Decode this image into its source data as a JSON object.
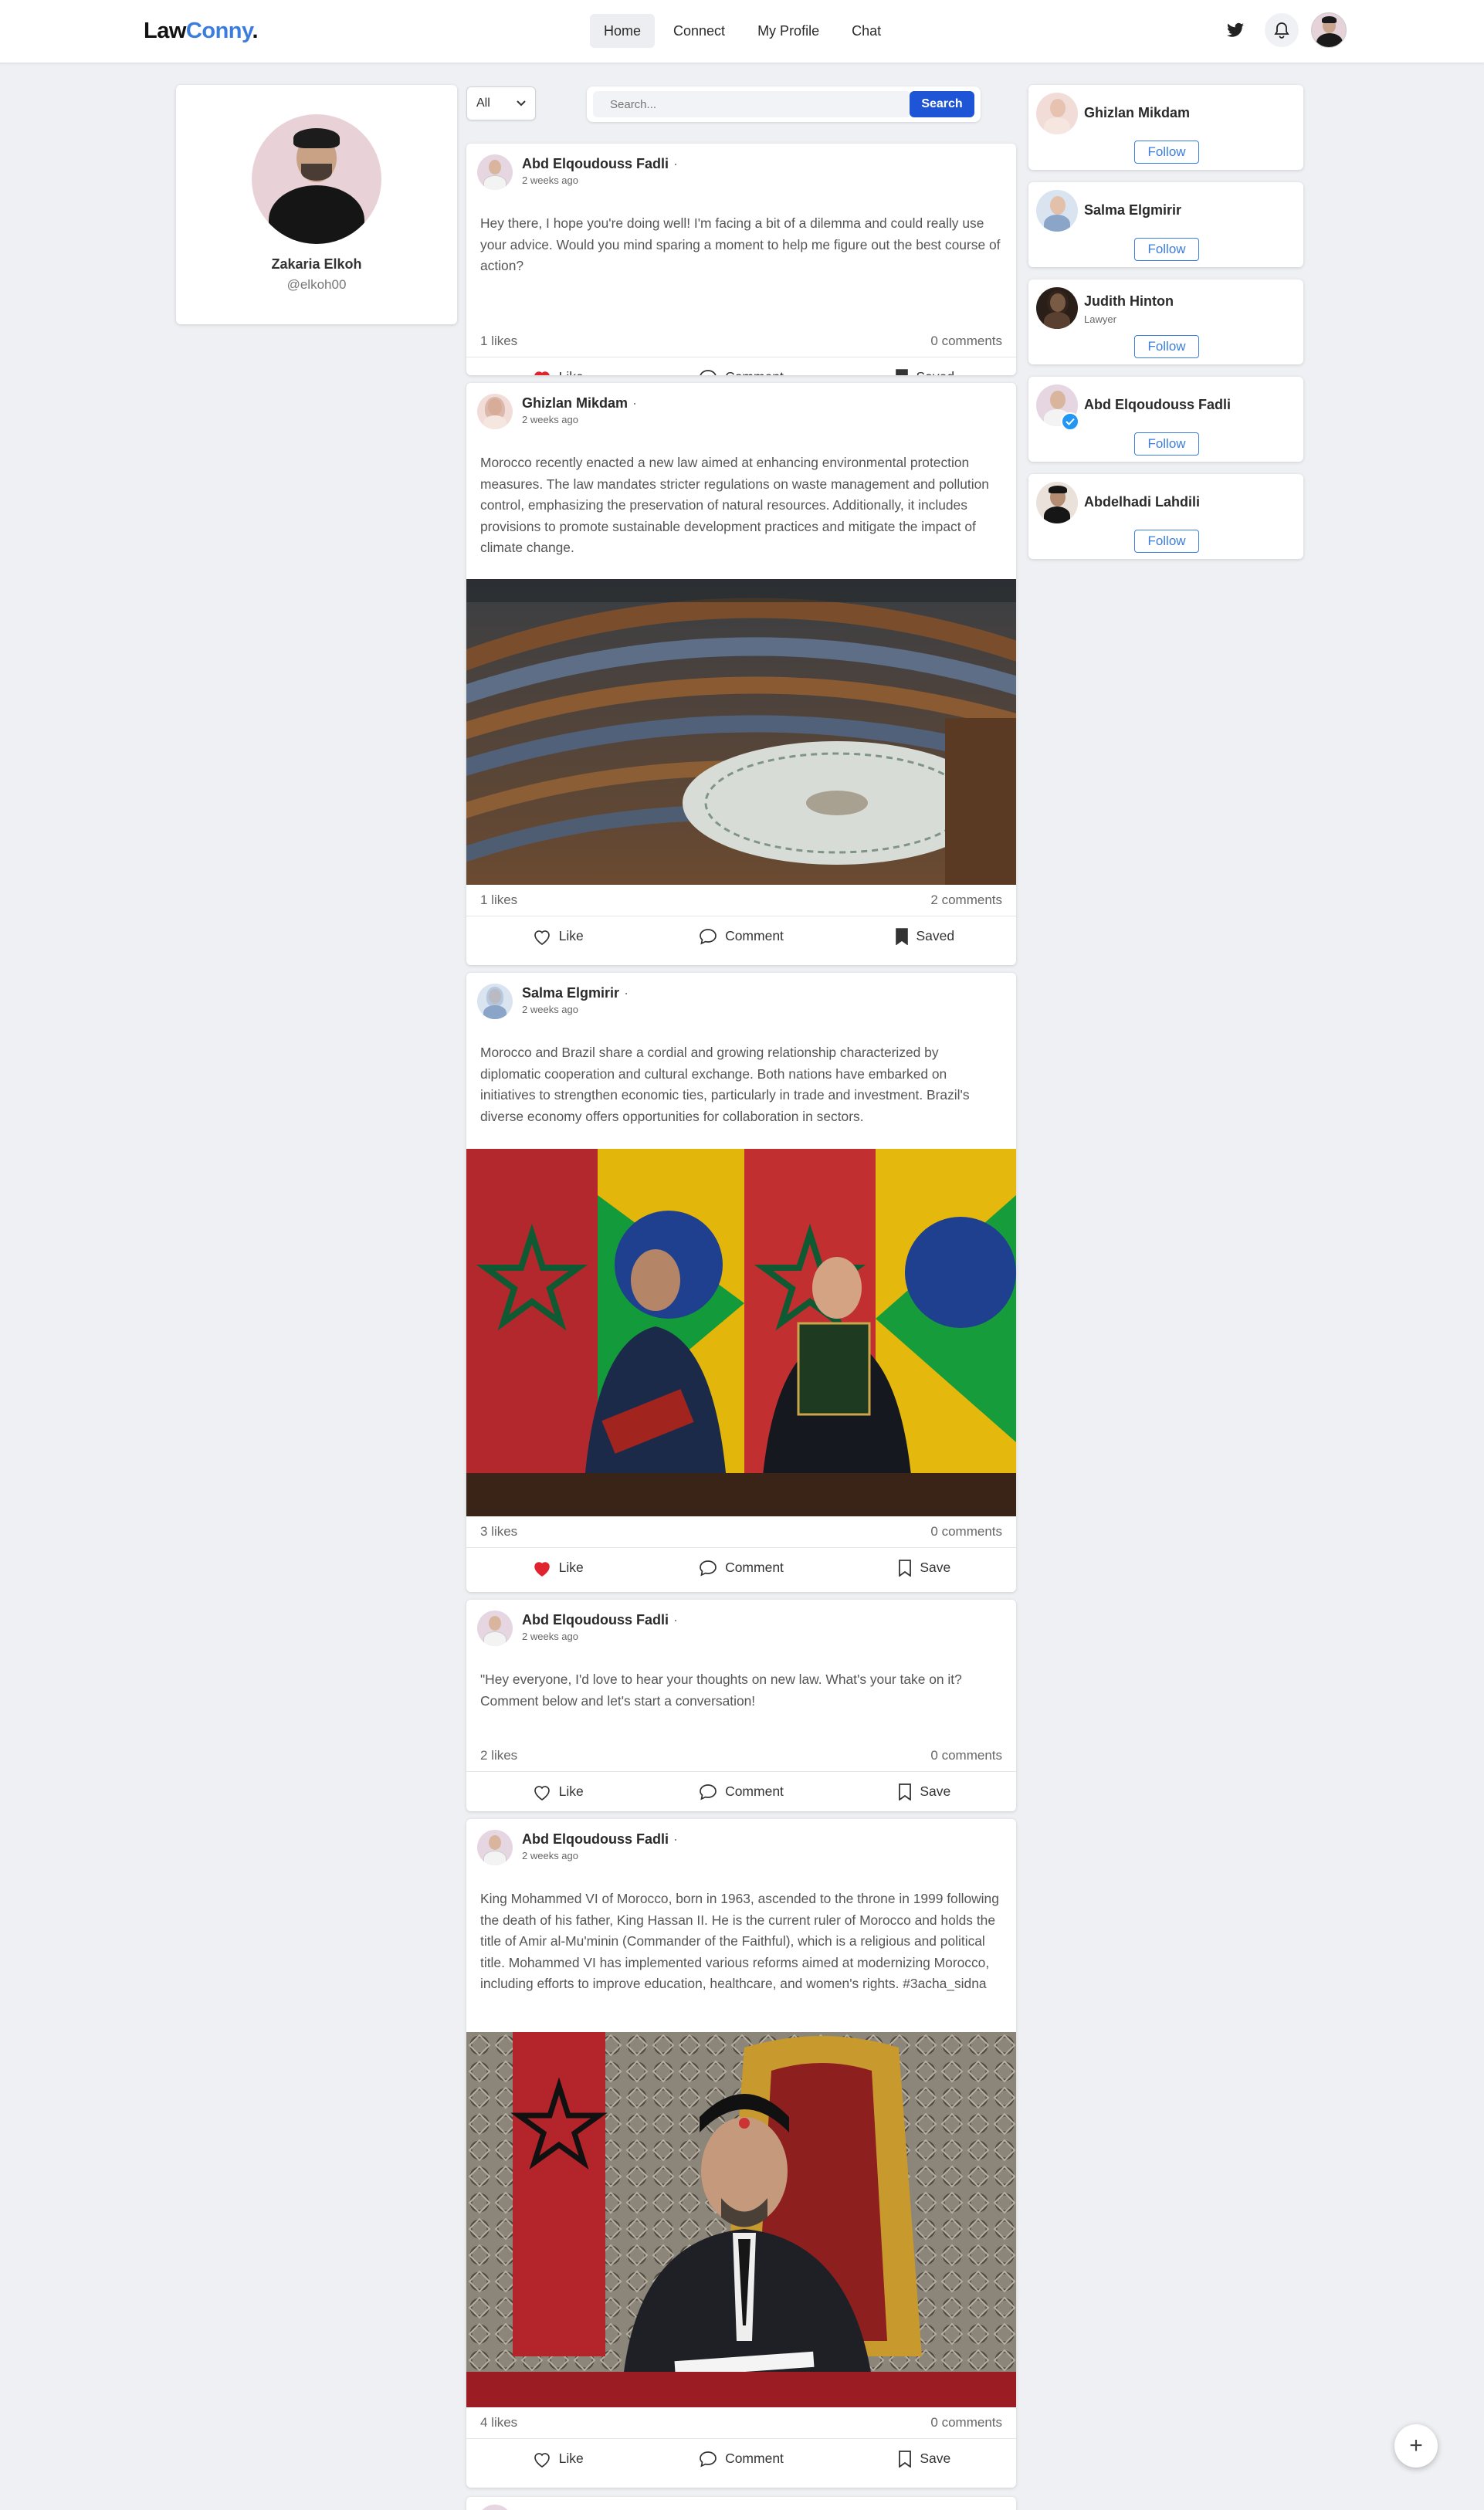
{
  "brand": {
    "name_main": "Law",
    "name_accent": "Conny",
    "name_dot": "."
  },
  "nav": {
    "links": [
      "Home",
      "Connect",
      "My Profile",
      "Chat"
    ],
    "active": "Home"
  },
  "profile": {
    "name": "Zakaria Elkoh",
    "handle": "@elkoh00"
  },
  "filter": {
    "selected": "All"
  },
  "search": {
    "placeholder": "Search...",
    "button": "Search"
  },
  "posts": [
    {
      "author": "Abd Elqoudouss Fadli",
      "separator": "·",
      "time": "2 weeks ago",
      "text": "Hey there, I hope you're doing well! I'm facing a bit of a dilemma and could really use your advice. Would you mind sparing a moment to help me figure out the best course of action?",
      "likes": "1 likes",
      "comments": "0 comments",
      "like_label": "Like",
      "liked": true,
      "comment_label": "Comment",
      "save_label": "Saved",
      "saved": true
    },
    {
      "author": "Ghizlan Mikdam",
      "separator": "·",
      "time": "2 weeks ago",
      "text": "Morocco recently enacted a new law aimed at enhancing environmental protection measures. The law mandates stricter regulations on waste management and pollution control, emphasizing the preservation of natural resources. Additionally, it includes provisions to promote sustainable development practices and mitigate the impact of climate change.",
      "likes": "1 likes",
      "comments": "2 comments",
      "like_label": "Like",
      "liked": false,
      "comment_label": "Comment",
      "save_label": "Saved",
      "saved": true
    },
    {
      "author": "Salma Elgmirir",
      "separator": "·",
      "time": "2 weeks ago",
      "text": "Morocco and Brazil share a cordial and growing relationship characterized by diplomatic cooperation and cultural exchange. Both nations have embarked on initiatives to strengthen economic ties, particularly in trade and investment. Brazil's diverse economy offers opportunities for collaboration in sectors.",
      "likes": "3 likes",
      "comments": "0 comments",
      "like_label": "Like",
      "liked": true,
      "comment_label": "Comment",
      "save_label": "Save",
      "saved": false
    },
    {
      "author": "Abd Elqoudouss Fadli",
      "separator": "·",
      "time": "2 weeks ago",
      "text": "\"Hey everyone, I'd love to hear your thoughts on new law. What's your take on it? Comment below and let's start a conversation!",
      "likes": "2 likes",
      "comments": "0 comments",
      "like_label": "Like",
      "liked": false,
      "comment_label": "Comment",
      "save_label": "Save",
      "saved": false
    },
    {
      "author": "Abd Elqoudouss Fadli",
      "separator": "·",
      "time": "2 weeks ago",
      "text": "King Mohammed VI of Morocco, born in 1963, ascended to the throne in 1999 following the death of his father, King Hassan II. He is the current ruler of Morocco and holds the title of Amir al-Mu'minin (Commander of the Faithful), which is a religious and political title. Mohammed VI has implemented various reforms aimed at modernizing Morocco, including efforts to improve education, healthcare, and women's rights. #3acha_sidna",
      "likes": "4 likes",
      "comments": "0 comments",
      "like_label": "Like",
      "liked": false,
      "comment_label": "Comment",
      "save_label": "Save",
      "saved": false
    }
  ],
  "suggestions": [
    {
      "name": "Ghizlan Mikdam",
      "role": "",
      "follow": "Follow"
    },
    {
      "name": "Salma Elgmirir",
      "role": "",
      "follow": "Follow"
    },
    {
      "name": "Judith Hinton",
      "role": "Lawyer",
      "follow": "Follow"
    },
    {
      "name": "Abd Elqoudouss Fadli",
      "role": "",
      "follow": "Follow"
    },
    {
      "name": "Abdelhadi Lahdili",
      "role": "",
      "follow": "Follow"
    }
  ],
  "fab": {
    "label": "+"
  },
  "colors": {
    "accent": "#3b7ddd",
    "search_button": "#1d55d6",
    "like_red": "#e0242f",
    "verified": "#2196f3"
  },
  "icons": [
    "twitter-icon",
    "bell-icon",
    "heart-icon",
    "comment-icon",
    "bookmark-icon",
    "plus-icon",
    "verified-badge-icon",
    "chevron-down-icon"
  ]
}
